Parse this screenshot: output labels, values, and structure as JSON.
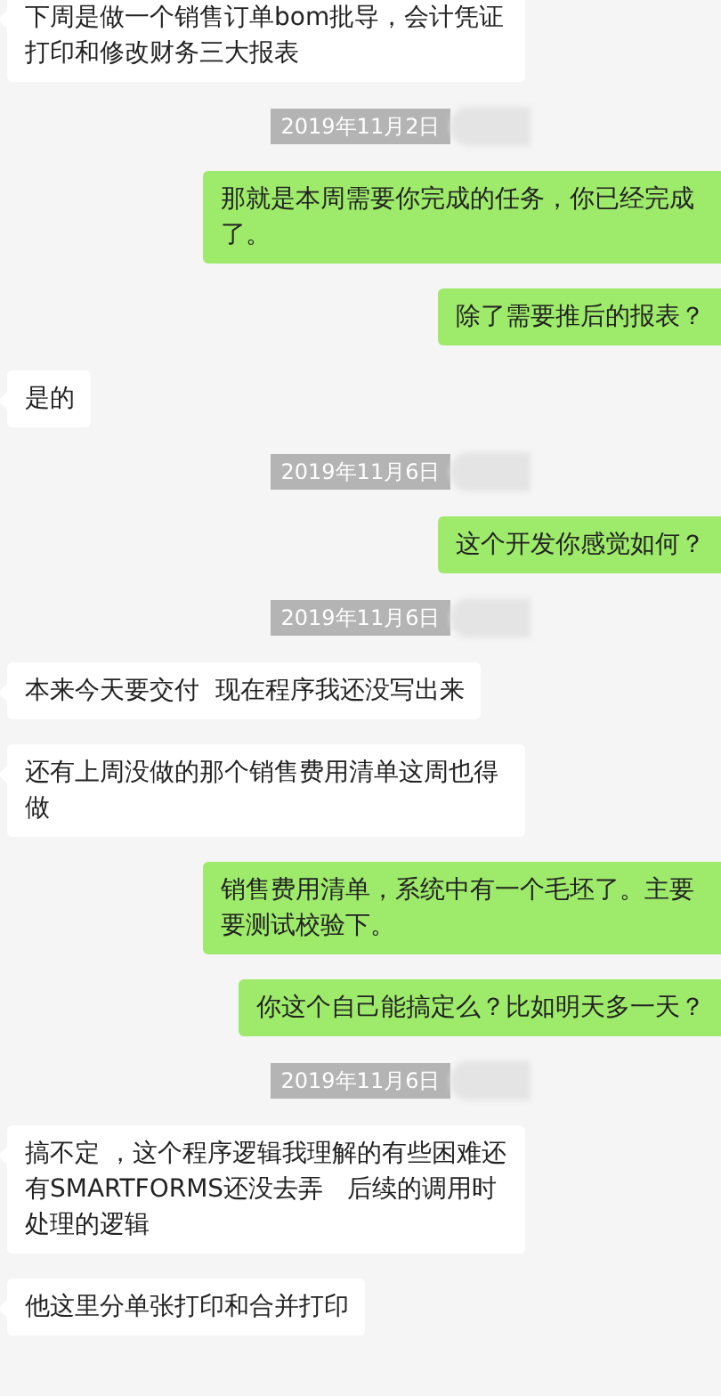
{
  "messages": [
    {
      "kind": "received",
      "text": "下周是做一个销售订单bom批导，会计凭证打印和修改财务三大报表"
    },
    {
      "kind": "date",
      "text": "2019年11月2日"
    },
    {
      "kind": "sent",
      "text": "那就是本周需要你完成的任务，你已经完成了。"
    },
    {
      "kind": "sent",
      "text": "除了需要推后的报表？"
    },
    {
      "kind": "received",
      "text": "是的"
    },
    {
      "kind": "date",
      "text": "2019年11月6日"
    },
    {
      "kind": "sent",
      "text": "这个开发你感觉如何？"
    },
    {
      "kind": "date",
      "text": "2019年11月6日"
    },
    {
      "kind": "received",
      "text": "本来今天要交付  现在程序我还没写出来"
    },
    {
      "kind": "received",
      "text": "还有上周没做的那个销售费用清单这周也得做"
    },
    {
      "kind": "sent",
      "text": "销售费用清单，系统中有一个毛坯了。主要要测试校验下。"
    },
    {
      "kind": "sent",
      "text": "你这个自己能搞定么？比如明天多一天？"
    },
    {
      "kind": "date",
      "text": "2019年11月6日"
    },
    {
      "kind": "received",
      "text": "搞不定 ，这个程序逻辑我理解的有些困难还有SMARTFORMS还没去弄   后续的调用时处理的逻辑"
    },
    {
      "kind": "received",
      "text": "他这里分单张打印和合并打印"
    }
  ]
}
